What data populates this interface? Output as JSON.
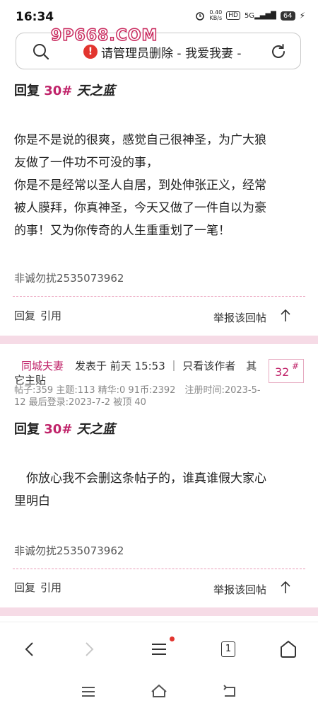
{
  "status": {
    "time": "16:34",
    "net_speed": "0.40",
    "net_unit": "KB/s",
    "hd": "HD",
    "signal": "5G",
    "battery": "64"
  },
  "watermark": "9P668.COM",
  "address": {
    "title": "请管理员删除 - 我爱我妻 -"
  },
  "post1": {
    "reply_label": "回复",
    "floor_ref": "30#",
    "reply_to": "天之蓝",
    "body": [
      "你是不是说的很爽，感觉自己很神圣，为广大狼",
      "友做了一件功不可没的事，",
      "你是不是经常以圣人自居，到处伸张正义，经常",
      "被人膜拜，你真神圣，今天又做了一件自以为豪",
      "的事！又为你传奇的人生重重划了一笔！"
    ],
    "signature": "非诚勿扰2535073962",
    "actions": {
      "reply": "回复",
      "quote": "引用",
      "report": "举报该回帖"
    }
  },
  "post2": {
    "author": "同城夫妻",
    "meta_line1": "发表于 前天 15:53 ｜ 只看该作者　其",
    "meta_line2": "它主贴",
    "floor_num": "32",
    "floor_hash": "#",
    "stats_line1": "帖子:359 主题:113 精华:0 91币:2392　注册时间:2023-5-",
    "stats_line2": "12 最后登录:2023-7-2 被顶 40",
    "reply_label": "回复",
    "floor_ref": "30#",
    "reply_to": "天之蓝",
    "body": [
      "　你放心我不会删这条帖子的，谁真谁假大家心",
      "里明白"
    ],
    "signature": "非诚勿扰2535073962",
    "actions": {
      "reply": "回复",
      "quote": "引用",
      "report": "举报该回帖"
    }
  },
  "browser_nav": {
    "tabs_count": "1"
  },
  "colors": {
    "accent": "#c0246a",
    "separator": "#f6dbe6",
    "dashed": "#e89ab7",
    "alert": "#e2352f"
  }
}
